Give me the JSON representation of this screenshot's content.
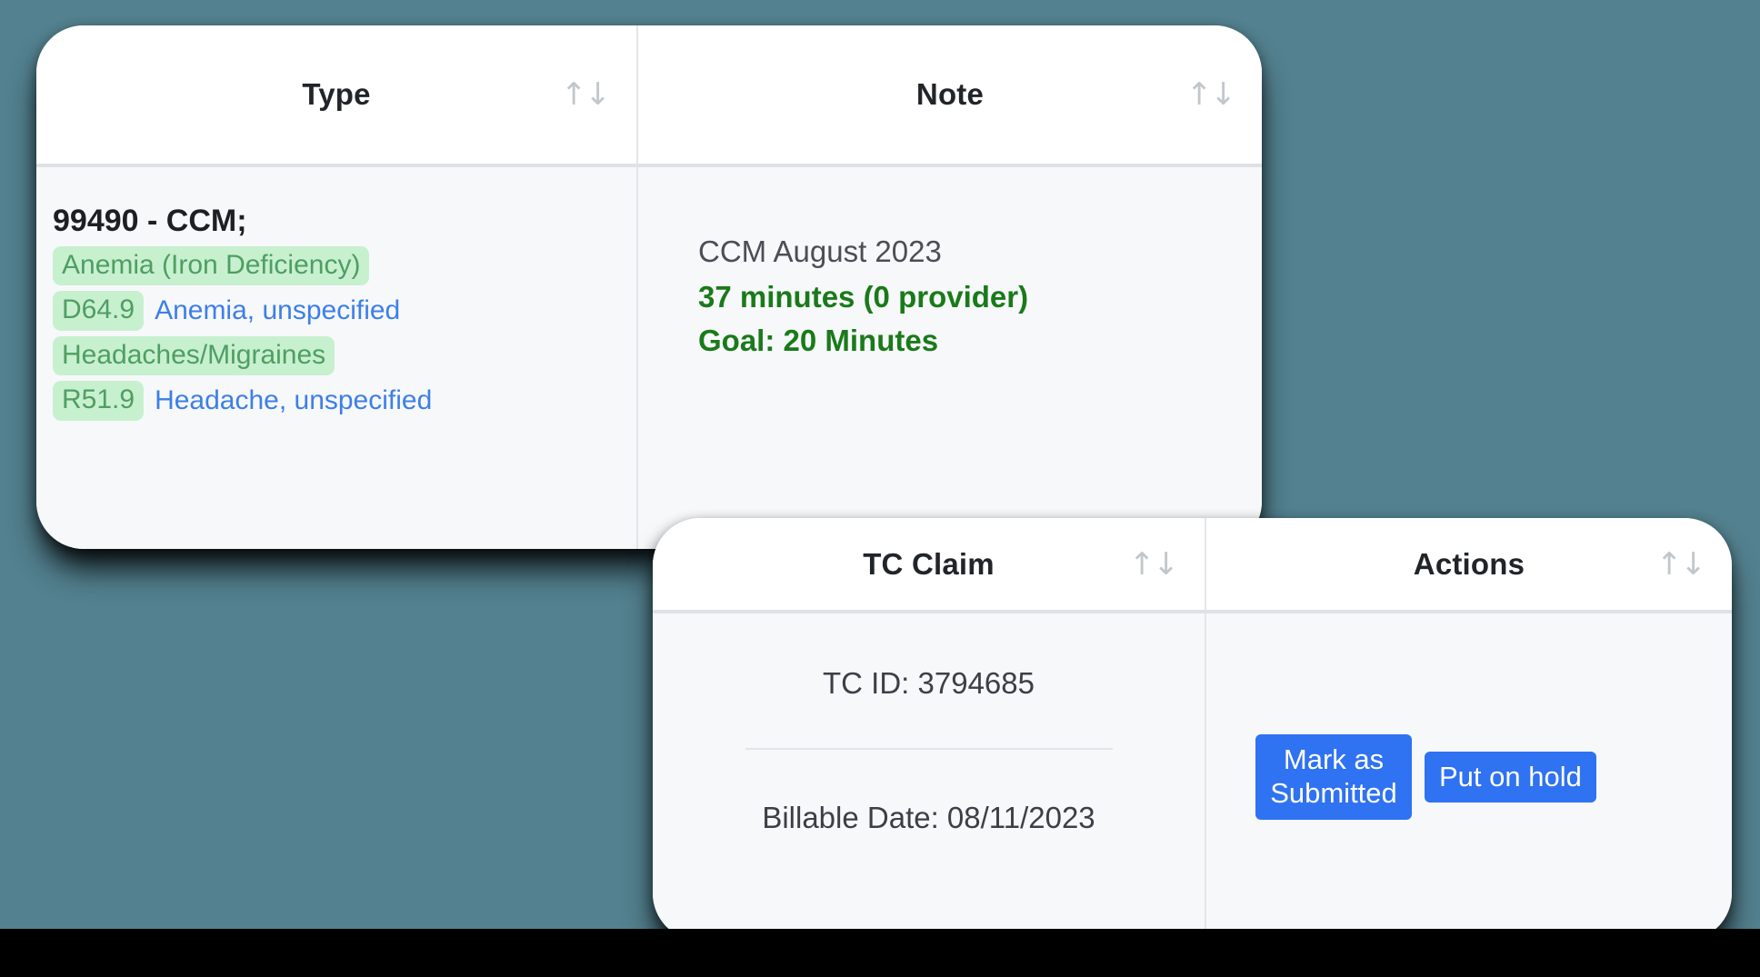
{
  "background": {
    "page_color": "#53818f",
    "bottom_bar_color": "#000000"
  },
  "colors": {
    "accent_blue": "#2f72f2",
    "tag_background": "#c7f0cf",
    "tag_text": "#4f9e63",
    "diagnosis_text": "#3d7fe8",
    "note_green": "#1a7a1a",
    "header_text": "#212529",
    "sort_icon": "#c2c7cc",
    "cell_background": "#f7f8fa"
  },
  "card_type_note": {
    "columns": [
      {
        "label": "Type",
        "sort_icon": "↑↓"
      },
      {
        "label": "Note",
        "sort_icon": "↑↓"
      }
    ],
    "type_cell": {
      "cpt": "99490 - CCM;",
      "diagnoses": [
        {
          "tag": "Anemia (Iron Deficiency)",
          "description": ""
        },
        {
          "tag": "D64.9",
          "description": "Anemia, unspecified"
        },
        {
          "tag": "Headaches/Migraines",
          "description": ""
        },
        {
          "tag": "R51.9",
          "description": "Headache, unspecified"
        }
      ]
    },
    "note_cell": {
      "title": "CCM August 2023",
      "minutes": "37 minutes (0 provider)",
      "goal": "Goal: 20 Minutes"
    }
  },
  "card_claim_actions": {
    "columns": [
      {
        "label": "TC Claim",
        "sort_icon": "↑↓"
      },
      {
        "label": "Actions",
        "sort_icon": "↑↓"
      }
    ],
    "claim_cell": {
      "tc_id": "TC ID: 3794685",
      "billable_date": "Billable Date: 08/11/2023"
    },
    "actions_cell": {
      "mark_as_submitted": "Mark as Submitted",
      "put_on_hold": "Put on hold"
    }
  }
}
